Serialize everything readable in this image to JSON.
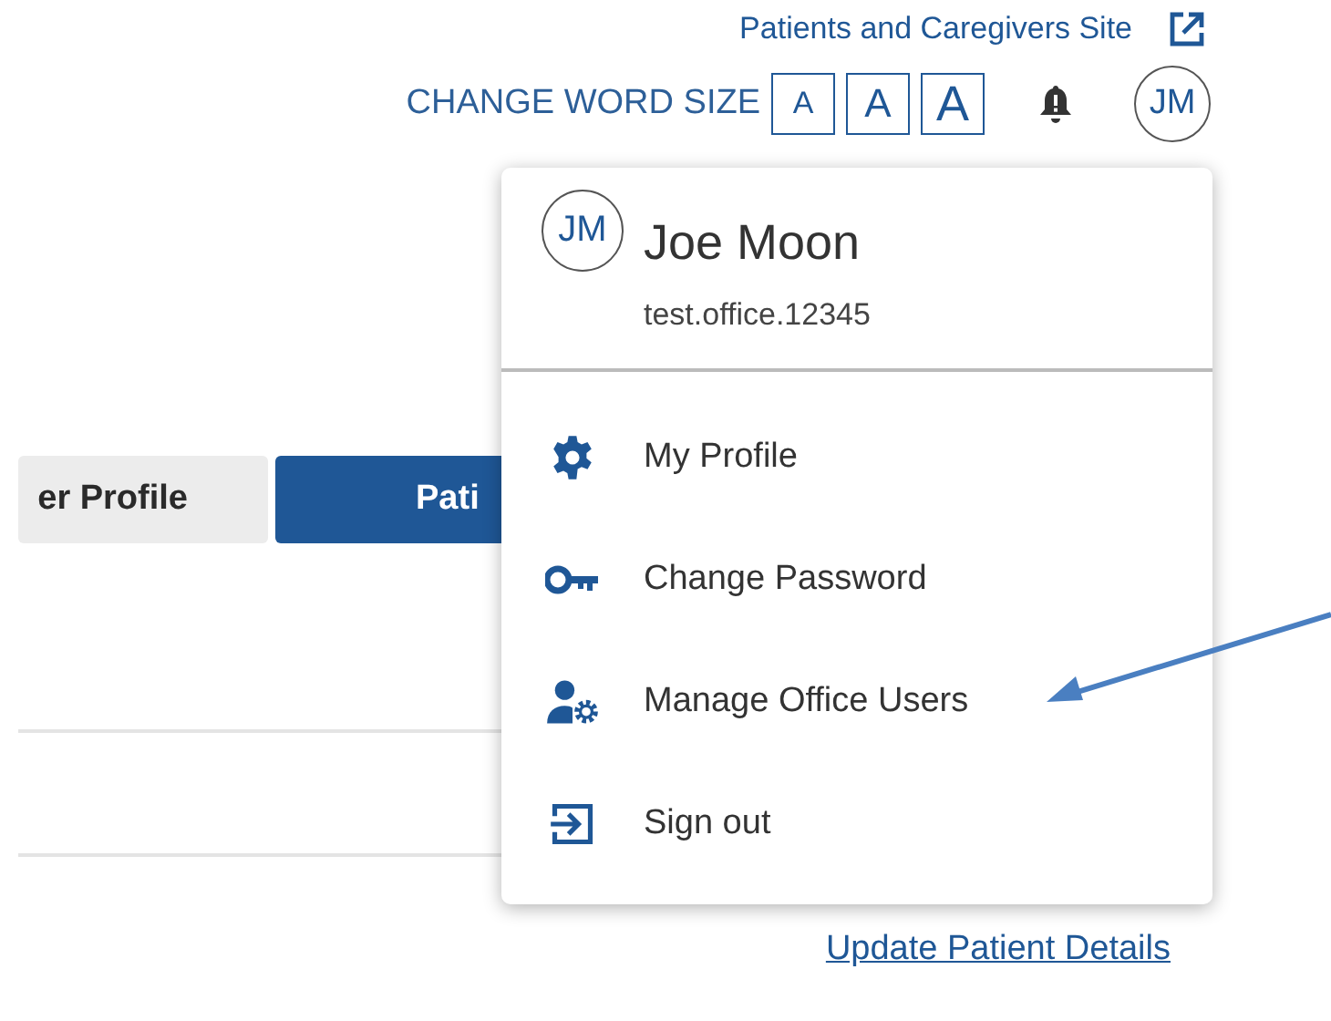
{
  "header": {
    "site_link": "Patients and Caregivers Site",
    "word_size_label": "CHANGE WORD SIZE",
    "word_size_buttons": [
      "A",
      "A",
      "A"
    ],
    "avatar": "JM"
  },
  "tabs": [
    {
      "label": "er Profile",
      "selected": false
    },
    {
      "label": "Pati",
      "selected": true
    }
  ],
  "update_link": "Update Patient Details",
  "user_menu": {
    "avatar": "JM",
    "name": "Joe Moon",
    "username": "test.office.12345",
    "items": [
      {
        "label": "My Profile"
      },
      {
        "label": "Change Password"
      },
      {
        "label": "Manage Office Users"
      },
      {
        "label": "Sign out"
      }
    ]
  }
}
